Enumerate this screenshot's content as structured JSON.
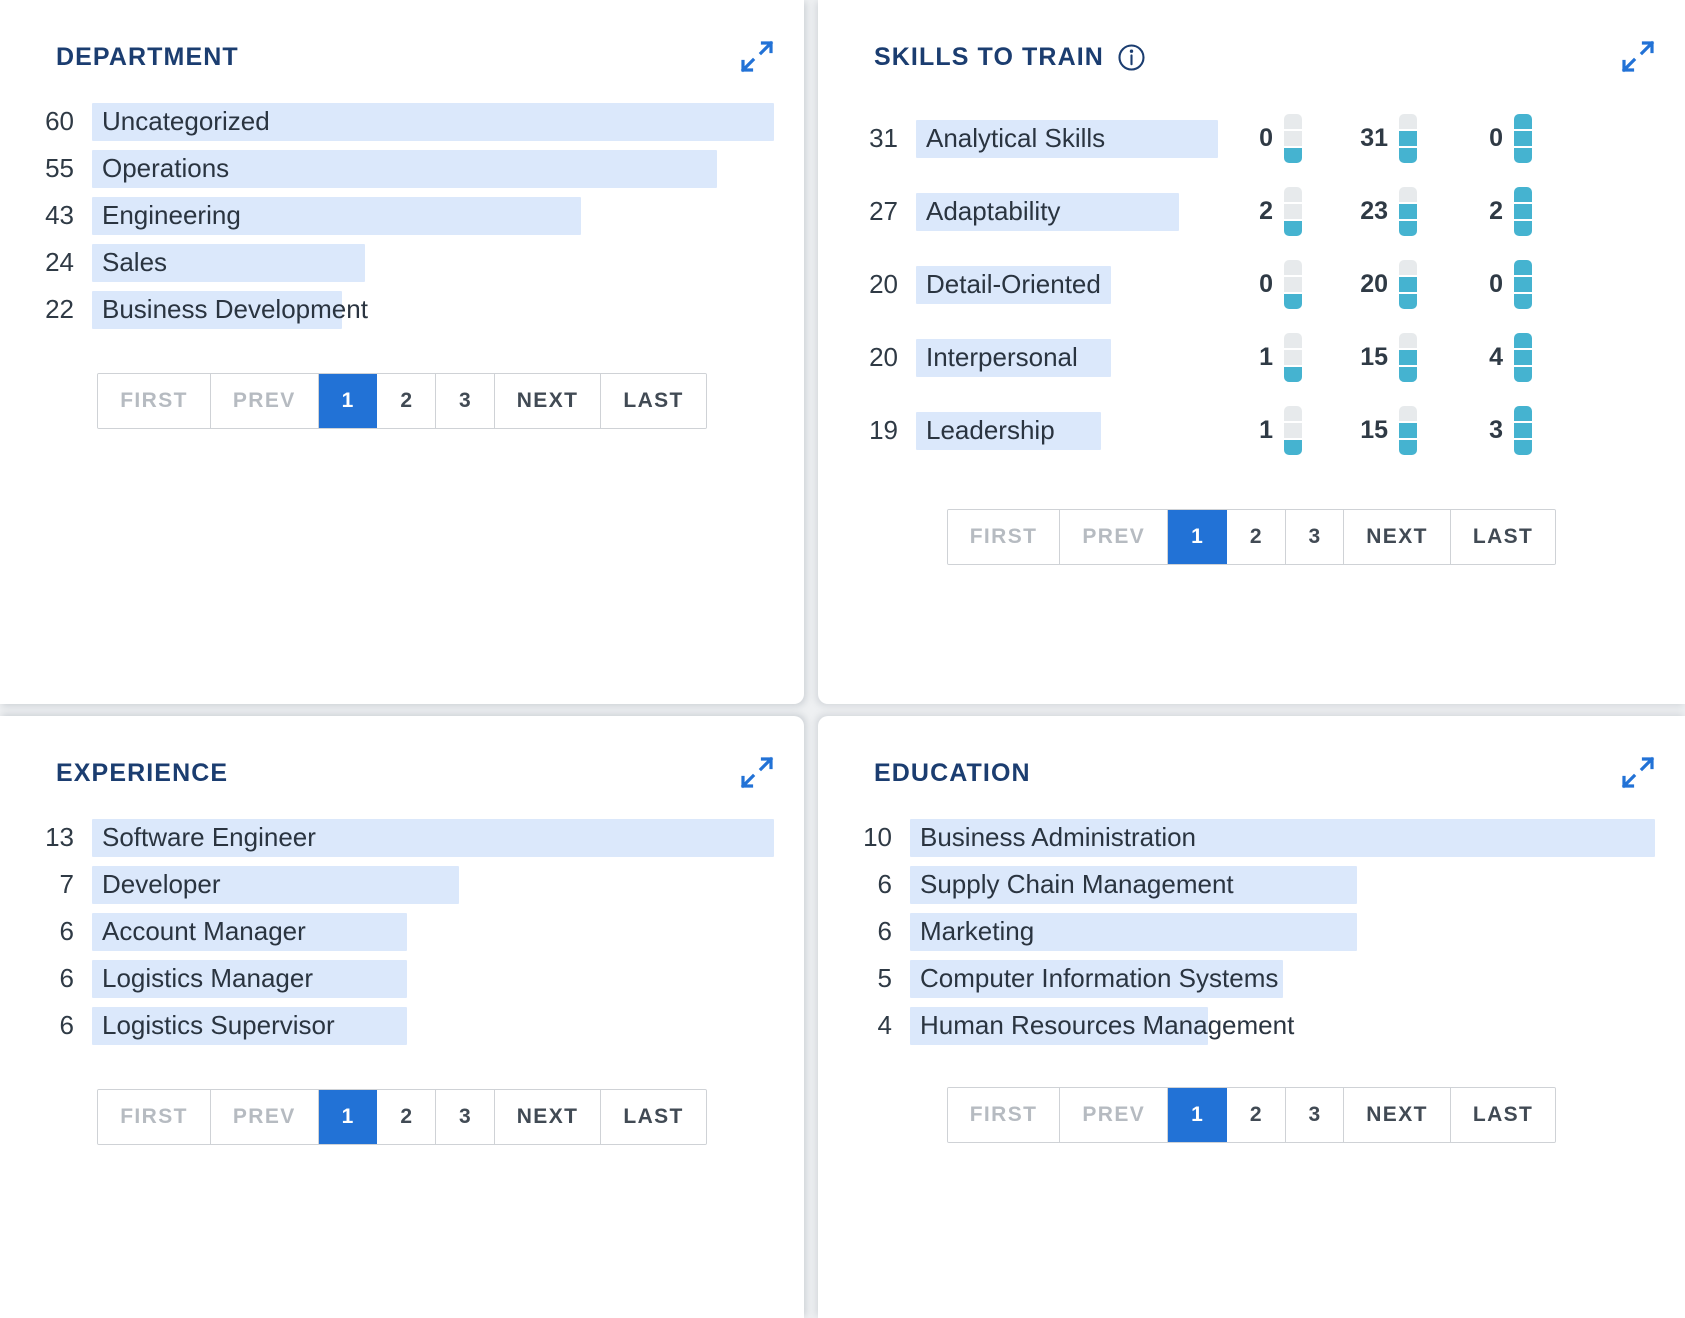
{
  "colors": {
    "title": "#1b3d70",
    "bar_fill": "#dbe8fb",
    "accent_blue": "#2272d6",
    "meter_on": "#45b3d0",
    "meter_off": "#e7eaec",
    "card_bg": "#ffffff",
    "page_bg": "#eef0f2"
  },
  "panels": {
    "department": {
      "title": "DEPARTMENT",
      "expand_icon": "expand-arrows-icon",
      "max_value": 60,
      "rows": [
        {
          "count": "60",
          "label": "Uncategorized",
          "value": 60
        },
        {
          "count": "55",
          "label": "Operations",
          "value": 55
        },
        {
          "count": "43",
          "label": "Engineering",
          "value": 43
        },
        {
          "count": "24",
          "label": "Sales",
          "value": 24
        },
        {
          "count": "22",
          "label": "Business Development",
          "value": 22
        }
      ]
    },
    "skills": {
      "title": "SKILLS TO TRAIN",
      "info_icon": "info-circle-icon",
      "expand_icon": "expand-arrows-icon",
      "max_value": 31,
      "rows": [
        {
          "count": "31",
          "label": "Analytical Skills",
          "value": 31,
          "meters": [
            {
              "num": "0",
              "level": 1
            },
            {
              "num": "31",
              "level": 2
            },
            {
              "num": "0",
              "level": 3
            }
          ]
        },
        {
          "count": "27",
          "label": "Adaptability",
          "value": 27,
          "meters": [
            {
              "num": "2",
              "level": 1
            },
            {
              "num": "23",
              "level": 2
            },
            {
              "num": "2",
              "level": 3
            }
          ]
        },
        {
          "count": "20",
          "label": "Detail-Oriented",
          "value": 20,
          "meters": [
            {
              "num": "0",
              "level": 1
            },
            {
              "num": "20",
              "level": 2
            },
            {
              "num": "0",
              "level": 3
            }
          ]
        },
        {
          "count": "20",
          "label": "Interpersonal",
          "value": 20,
          "meters": [
            {
              "num": "1",
              "level": 1
            },
            {
              "num": "15",
              "level": 2
            },
            {
              "num": "4",
              "level": 3
            }
          ]
        },
        {
          "count": "19",
          "label": "Leadership",
          "value": 19,
          "meters": [
            {
              "num": "1",
              "level": 1
            },
            {
              "num": "15",
              "level": 2
            },
            {
              "num": "3",
              "level": 3
            }
          ]
        }
      ]
    },
    "experience": {
      "title": "EXPERIENCE",
      "expand_icon": "expand-arrows-icon",
      "max_value": 13,
      "rows": [
        {
          "count": "13",
          "label": "Software Engineer",
          "value": 13
        },
        {
          "count": "7",
          "label": "Developer",
          "value": 7
        },
        {
          "count": "6",
          "label": "Account Manager",
          "value": 6
        },
        {
          "count": "6",
          "label": "Logistics Manager",
          "value": 6
        },
        {
          "count": "6",
          "label": "Logistics Supervisor",
          "value": 6
        }
      ]
    },
    "education": {
      "title": "EDUCATION",
      "expand_icon": "expand-arrows-icon",
      "max_value": 10,
      "rows": [
        {
          "count": "10",
          "label": "Business Administration",
          "value": 10
        },
        {
          "count": "6",
          "label": "Supply Chain Management",
          "value": 6
        },
        {
          "count": "6",
          "label": "Marketing",
          "value": 6
        },
        {
          "count": "5",
          "label": "Computer Information Systems",
          "value": 5
        },
        {
          "count": "4",
          "label": "Human Resources Management",
          "value": 4
        }
      ]
    }
  },
  "pagination": {
    "first": "FIRST",
    "prev": "PREV",
    "pages": [
      "1",
      "2",
      "3"
    ],
    "next": "NEXT",
    "last": "LAST",
    "active_page": "1",
    "first_disabled": true,
    "prev_disabled": true
  },
  "chart_data": [
    {
      "type": "bar",
      "title": "DEPARTMENT",
      "orientation": "horizontal",
      "categories": [
        "Uncategorized",
        "Operations",
        "Engineering",
        "Sales",
        "Business Development"
      ],
      "values": [
        60,
        55,
        43,
        24,
        22
      ],
      "xlabel": "",
      "ylabel": "",
      "xlim": [
        0,
        60
      ],
      "grid": false,
      "legend": "none"
    },
    {
      "type": "bar",
      "title": "SKILLS TO TRAIN",
      "orientation": "horizontal",
      "categories": [
        "Analytical Skills",
        "Adaptability",
        "Detail-Oriented",
        "Interpersonal",
        "Leadership"
      ],
      "values": [
        31,
        27,
        20,
        20,
        19
      ],
      "series": [
        {
          "name": "Level 1",
          "values": [
            0,
            2,
            0,
            1,
            1
          ]
        },
        {
          "name": "Level 2",
          "values": [
            31,
            23,
            20,
            15,
            15
          ]
        },
        {
          "name": "Level 3",
          "values": [
            0,
            2,
            0,
            4,
            3
          ]
        }
      ],
      "xlabel": "",
      "ylabel": "",
      "xlim": [
        0,
        31
      ],
      "grid": false,
      "legend": "none"
    },
    {
      "type": "bar",
      "title": "EXPERIENCE",
      "orientation": "horizontal",
      "categories": [
        "Software Engineer",
        "Developer",
        "Account Manager",
        "Logistics Manager",
        "Logistics Supervisor"
      ],
      "values": [
        13,
        7,
        6,
        6,
        6
      ],
      "xlabel": "",
      "ylabel": "",
      "xlim": [
        0,
        13
      ],
      "grid": false,
      "legend": "none"
    },
    {
      "type": "bar",
      "title": "EDUCATION",
      "orientation": "horizontal",
      "categories": [
        "Business Administration",
        "Supply Chain Management",
        "Marketing",
        "Computer Information Systems",
        "Human Resources Management"
      ],
      "values": [
        10,
        6,
        6,
        5,
        4
      ],
      "xlabel": "",
      "ylabel": "",
      "xlim": [
        0,
        10
      ],
      "grid": false,
      "legend": "none"
    }
  ]
}
